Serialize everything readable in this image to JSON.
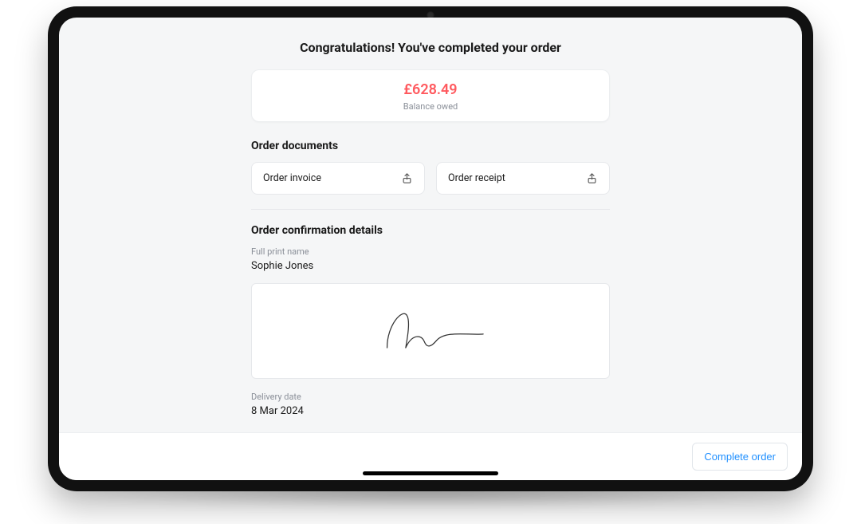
{
  "header": {
    "title": "Congratulations! You've completed your order"
  },
  "balance": {
    "amount": "£628.49",
    "label": "Balance owed"
  },
  "documents": {
    "section_title": "Order documents",
    "items": [
      {
        "label": "Order invoice"
      },
      {
        "label": "Order receipt"
      }
    ]
  },
  "confirmation": {
    "section_title": "Order confirmation details",
    "full_name_label": "Full print name",
    "full_name_value": "Sophie Jones",
    "delivery_date_label": "Delivery date",
    "delivery_date_value": "8 Mar 2024"
  },
  "footer": {
    "complete_label": "Complete order"
  }
}
